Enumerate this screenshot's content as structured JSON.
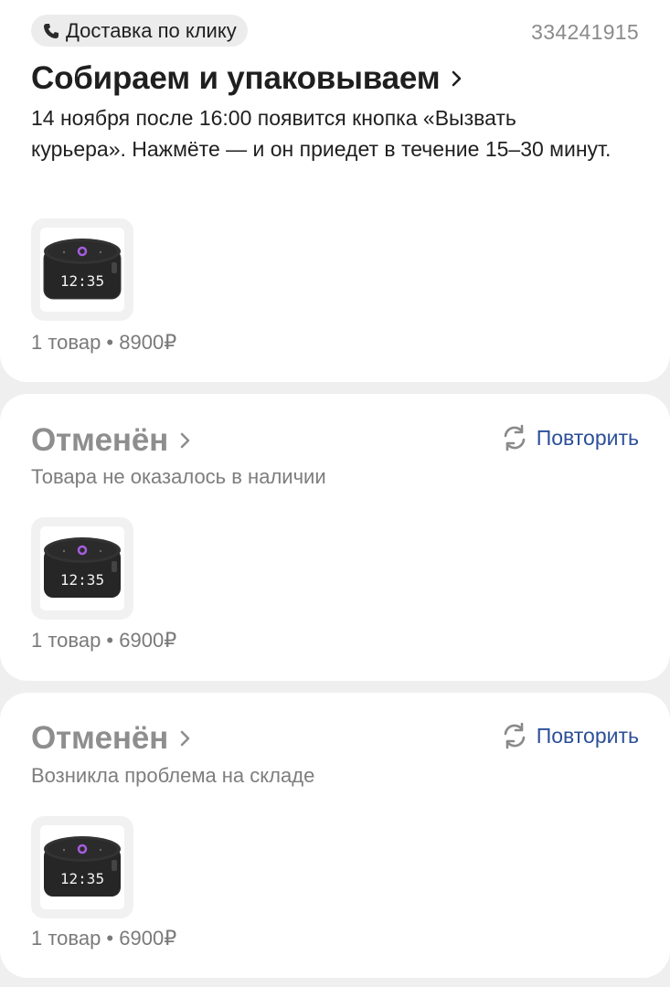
{
  "orders": [
    {
      "delivery_tag": "Доставка по клику",
      "order_number": "334241915",
      "status": "Собираем и упаковываем",
      "description": "14 ноября после 16:00 появится кнопка «Вызвать курьера». Нажмёте — и он приедет в течение 15–30 минут.",
      "summary": "1 товар • 8900₽"
    },
    {
      "status": "Отменён",
      "reason": "Товара не оказалось в наличии",
      "repeat_label": "Повторить",
      "summary": "1 товар • 6900₽"
    },
    {
      "status": "Отменён",
      "reason": "Возникла проблема на складе",
      "repeat_label": "Повторить",
      "summary": "1 товар • 6900₽"
    }
  ],
  "product_display": "12:35",
  "icons": {
    "tag": "phone-icon",
    "chevron": "chevron-right-icon",
    "repeat": "refresh-icon"
  },
  "colors": {
    "link": "#2c4f99",
    "muted_text": "#7a7a7a",
    "cancelled_status": "#8e8e8e",
    "background": "#efefef",
    "card": "#ffffff"
  }
}
